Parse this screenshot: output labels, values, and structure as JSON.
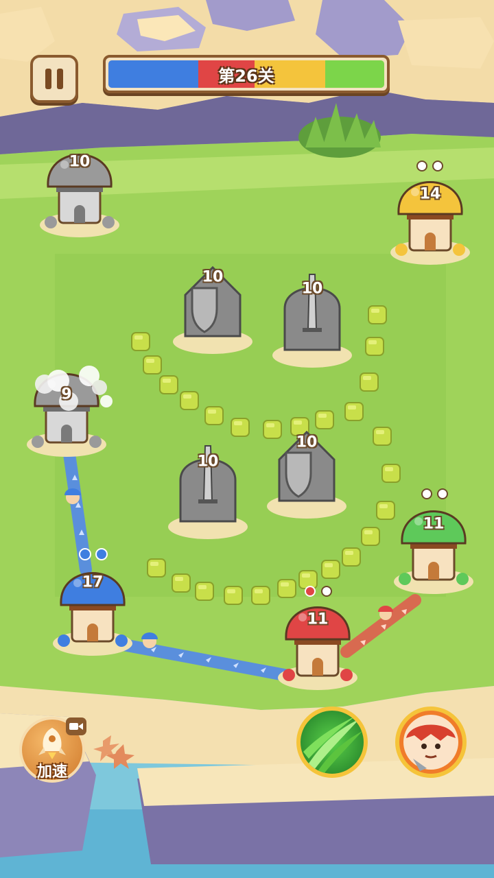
{
  "hud": {
    "pause_icon": "pause-icon",
    "level_label": "第26关",
    "territory_share": [
      {
        "team": "blue",
        "color": "#3f7ee0",
        "fraction": 0.325
      },
      {
        "team": "red",
        "color": "#e04545",
        "fraction": 0.205
      },
      {
        "team": "yellow",
        "color": "#f4c43c",
        "fraction": 0.255
      },
      {
        "team": "green",
        "color": "#7cd54a",
        "fraction": 0.215
      }
    ]
  },
  "towers": [
    {
      "id": "gray-top-left",
      "team": "neutral",
      "type": "mushroom",
      "count": "10",
      "color": "#9a9a9a"
    },
    {
      "id": "gray-shield-top",
      "team": "neutral",
      "type": "shield",
      "count": "10",
      "color": "#9a9a9a"
    },
    {
      "id": "gray-sword-top",
      "team": "neutral",
      "type": "sword",
      "count": "10",
      "color": "#9a9a9a"
    },
    {
      "id": "yellow-right",
      "team": "yellow",
      "type": "mushroom",
      "count": "14",
      "color": "#f4c43c"
    },
    {
      "id": "gray-smoke-left",
      "team": "neutral",
      "type": "mushroom",
      "count": "9",
      "color": "#9a9a9a"
    },
    {
      "id": "gray-sword-mid",
      "team": "neutral",
      "type": "sword",
      "count": "10",
      "color": "#9a9a9a"
    },
    {
      "id": "gray-shield-mid",
      "team": "neutral",
      "type": "shield",
      "count": "10",
      "color": "#9a9a9a"
    },
    {
      "id": "green-right",
      "team": "green",
      "type": "mushroom",
      "count": "11",
      "color": "#5ec95a"
    },
    {
      "id": "blue-left",
      "team": "blue",
      "type": "mushroom",
      "count": "17",
      "color": "#3f7ee0"
    },
    {
      "id": "red-bottom",
      "team": "red",
      "type": "mushroom",
      "count": "11",
      "color": "#e04545"
    }
  ],
  "controls": {
    "speed_label": "加速",
    "speed_icon": "rocket-icon",
    "video_icon": "video-camera-icon",
    "skill_leaf_icon": "leaf-storm-icon",
    "skill_hero_icon": "hero-portrait-icon"
  }
}
